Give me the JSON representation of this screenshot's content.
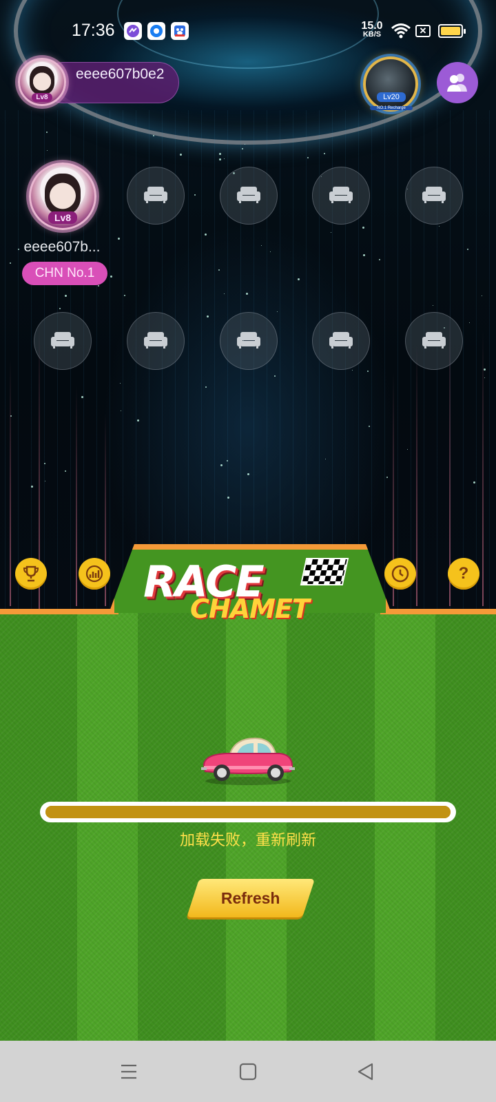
{
  "status_bar": {
    "time": "17:36",
    "network_speed": "15.0",
    "network_unit": "KB/S",
    "icons": [
      "messenger-icon",
      "app-icon",
      "baidu-icon",
      "wifi-icon",
      "no-sim-icon",
      "battery-icon"
    ]
  },
  "header": {
    "host_name": "eeee607b0e2",
    "host_level": "Lv8",
    "rank_level": "Lv20",
    "rank_caption": "NO.1 Recharge"
  },
  "seats": {
    "occupied": {
      "name": "eeee607b...",
      "level": "Lv8",
      "badge": "CHN No.1"
    },
    "empty_icon": "sofa-icon"
  },
  "game": {
    "logo_top": "RACE",
    "logo_bottom": "CHAMET",
    "left_buttons": [
      "trophy-icon",
      "chart-icon"
    ],
    "right_buttons": [
      "clock-icon",
      "help-icon"
    ],
    "help_label": "?",
    "load_progress": 1.0,
    "load_message": "加载失败，重新刷新",
    "refresh_label": "Refresh"
  },
  "navbar": {
    "buttons": [
      "menu-icon",
      "home-icon",
      "back-icon"
    ]
  },
  "colors": {
    "accent_orange": "#f59a38",
    "gold": "#f5c21c",
    "grass": "#449521",
    "message_yellow": "#ffe04a",
    "host_pill": "#5a1e6e"
  }
}
